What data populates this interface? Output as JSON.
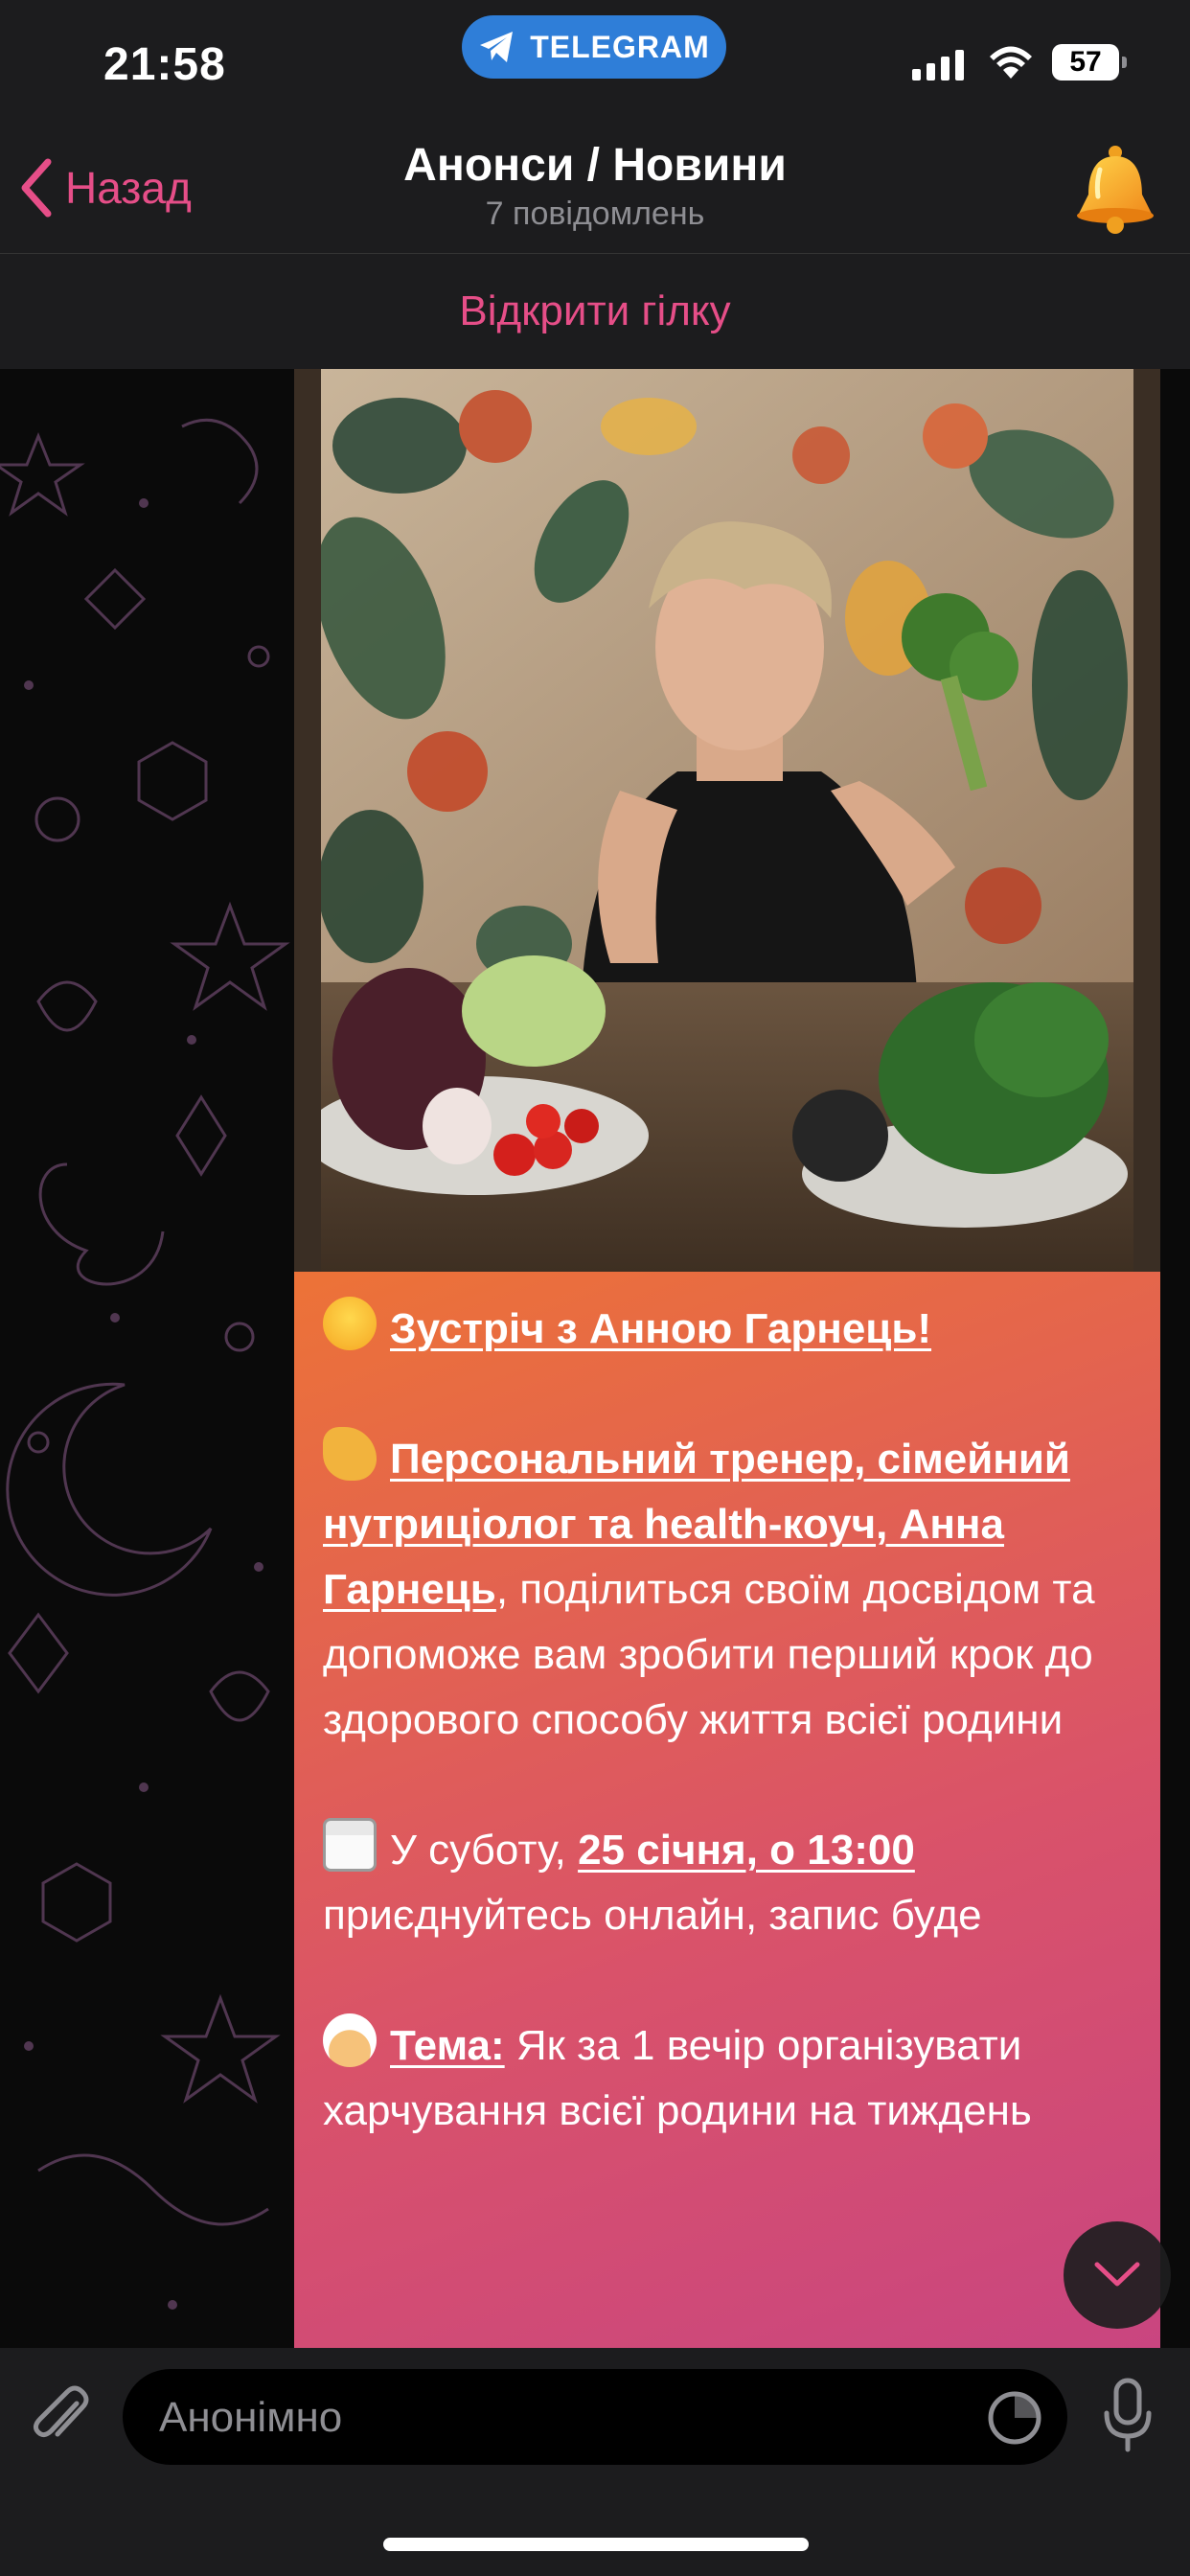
{
  "status": {
    "time": "21:58",
    "app_pill": "TELEGRAM",
    "battery": "57"
  },
  "header": {
    "back_label": "Назад",
    "title": "Анонси / Новини",
    "subtitle": "7 повідомлень"
  },
  "thread": {
    "open_label": "Відкрити гілку"
  },
  "message": {
    "heading": "Зустріч з Анною Гарнець!",
    "p2_link": "Персональний тренер, сімейний нутриціолог та health-коуч, Анна Гарнець",
    "p2_rest": ", поділиться своїм досвідом та допоможе вам зробити перший крок до здорового способу життя всієї родини",
    "p3_pre": "У суботу, ",
    "p3_link": "25 січня, о 13:00",
    "p3_rest": "приєднуйтесь онлайн, запис буде",
    "p4_label": "Тема:",
    "p4_rest": " Як за 1 вечір організувати харчування всієї родини на тиждень"
  },
  "composer": {
    "placeholder": "Анонімно"
  },
  "colors": {
    "accent": "#e64e88",
    "pill": "#2f7ed8",
    "bubble_start": "#f08a2c",
    "bubble_end": "#c94580"
  },
  "icons": [
    "back-chevron-icon",
    "telegram-icon",
    "signal-icon",
    "wifi-icon",
    "battery-icon",
    "bell-icon",
    "attach-icon",
    "sticker-icon",
    "mic-icon",
    "chevron-down-icon"
  ]
}
